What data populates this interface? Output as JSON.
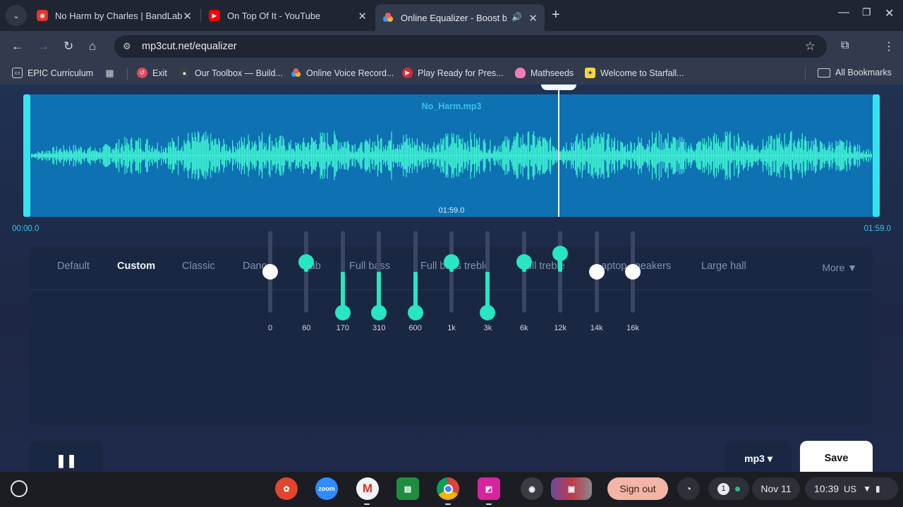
{
  "browser": {
    "tabs": [
      {
        "title": "No Harm by Charles | BandLab",
        "active": false
      },
      {
        "title": "On Top Of It - YouTube",
        "active": false
      },
      {
        "title": "Online Equalizer - Boost bass",
        "active": true
      }
    ],
    "url": "mp3cut.net/equalizer",
    "bookmarks": [
      {
        "label": "EPIC Curriculum"
      },
      {
        "label": "Exit"
      },
      {
        "label": "Our Toolbox — Build..."
      },
      {
        "label": "Online Voice Record..."
      },
      {
        "label": "Play Ready for Pres..."
      },
      {
        "label": "Mathseeds"
      },
      {
        "label": "Welcome to Starfall..."
      }
    ],
    "all_bookmarks": "All Bookmarks"
  },
  "editor": {
    "filename": "No_Harm.mp3",
    "duration_mid": "01:59.0",
    "time_start": "00:00.0",
    "time_end": "01:59.0"
  },
  "equalizer": {
    "presets": [
      "Default",
      "Custom",
      "Classic",
      "Dance",
      "Club",
      "Full bass",
      "Full bass treble",
      "Full treble",
      "Laptop speakers",
      "Large hall"
    ],
    "active_preset": "Custom",
    "more_label": "More ▼",
    "bands": [
      {
        "label": "0",
        "level": 0.5,
        "active": false
      },
      {
        "label": "60",
        "level": 0.625,
        "active": true
      },
      {
        "label": "170",
        "level": 0.0,
        "active": true
      },
      {
        "label": "310",
        "level": 0.0,
        "active": true
      },
      {
        "label": "600",
        "level": 0.0,
        "active": true
      },
      {
        "label": "1k",
        "level": 0.625,
        "active": true
      },
      {
        "label": "3k",
        "level": 0.0,
        "active": true
      },
      {
        "label": "6k",
        "level": 0.625,
        "active": true
      },
      {
        "label": "12k",
        "level": 0.72,
        "active": true
      },
      {
        "label": "14k",
        "level": 0.5,
        "active": false
      },
      {
        "label": "16k",
        "level": 0.5,
        "active": false
      }
    ]
  },
  "controls": {
    "pause_label": "❚❚",
    "format_label": "mp3 ▾",
    "save_label": "Save"
  },
  "shelf": {
    "apps": [
      "Canvas",
      "zoom",
      "Gmail",
      "Classroom",
      "Chrome",
      "Jamboard",
      "Screen recorder",
      "Windows"
    ],
    "zoom_label": "zoom",
    "signout_label": "Sign out",
    "notification_count": "1",
    "date": "Nov 11",
    "time": "10:39",
    "locale": "US"
  },
  "colors": {
    "accent": "#27e6c1",
    "wave": "#3ef2d2",
    "wave_bg": "#0e71b2",
    "save_bg": "#ffffff"
  }
}
